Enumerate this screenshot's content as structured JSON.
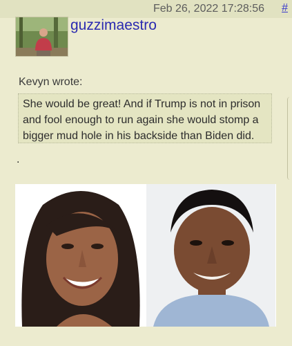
{
  "post": {
    "datetime": "Feb 26, 2022 17:28:56",
    "permalink": "#",
    "username": "guzzimaestro",
    "quote_label": "Kevyn wrote:",
    "quote_text": "She would be great! And if Trump is not in prison and fool enough to run again she would stomp a bigger mud hole in his backside than Biden did.",
    "body_text": "."
  },
  "colors": {
    "background": "#ecebcf",
    "link": "#2a2ab0",
    "quote_bg": "#e4e5c2"
  }
}
